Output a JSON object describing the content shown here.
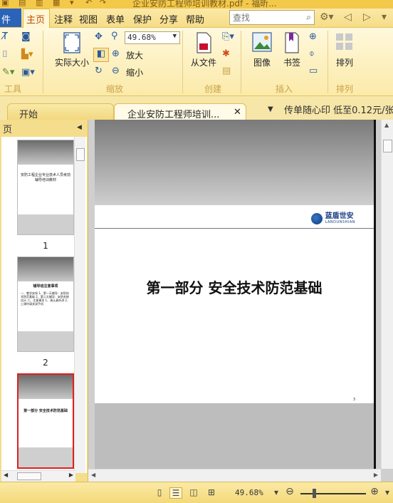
{
  "window": {
    "title": "企业安防工程师培训教材.pdf - 福昕..."
  },
  "menu": {
    "file_label": "件",
    "items": [
      "主页",
      "注释",
      "视图",
      "表单",
      "保护",
      "分享",
      "帮助"
    ],
    "search_placeholder": "查找"
  },
  "ribbon": {
    "zoom_value": "49.68%",
    "actual_size_label": "实际大小",
    "zoom_in_label": "放大",
    "zoom_out_label": "缩小",
    "from_file_label": "从文件",
    "image_label": "图像",
    "bookmark_label": "书签",
    "arrange_label": "排列",
    "groups": {
      "tools": "工具",
      "zoom": "缩放",
      "create": "创建",
      "insert": "插入",
      "arrange": "排列"
    }
  },
  "tabs": {
    "start": "开始",
    "document": "企业安防工程师培训...",
    "ad_text": "传单随心印 低至0.12元/张"
  },
  "thumbnails": {
    "panel_title": "页",
    "pages": [
      {
        "number": "1",
        "text": "安防工程企业专业技术人员考前辅导培训教材"
      },
      {
        "number": "2",
        "title": "辅导班注意事项",
        "text": "一、教学安排 1、第一天辅导：安防技术防范基础 2、第二天辅导：安防系统设计 二、注意事项 1、请认真听讲 2、上课时请关闭手机"
      },
      {
        "number": "",
        "text": "第一部分 安全技术防范基础"
      }
    ],
    "selected_index": 2
  },
  "document": {
    "logo_zh": "蓝盾世安",
    "logo_en": "LANDUNSHIAN",
    "heading": "第一部分  安全技术防范基础",
    "page_number": "3"
  },
  "statusbar": {
    "zoom_value": "49.68%",
    "zoom_level": 0.2
  },
  "colors": {
    "accent": "#f3c94a",
    "file_menu": "#2a63b9",
    "active_tab_text": "#c04b00",
    "selected_thumb_border": "#e02020"
  }
}
